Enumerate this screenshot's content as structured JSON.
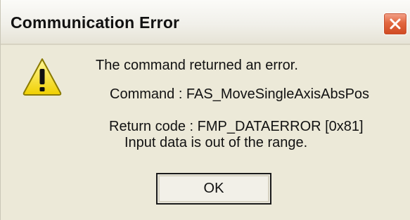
{
  "window": {
    "title": "Communication Error",
    "close_icon": "close-x-icon"
  },
  "message": {
    "icon": "warning-triangle-icon",
    "main": "The command returned an error.",
    "command": "Command : FAS_MoveSingleAxisAbsPos",
    "return_code": "Return code : FMP_DATAERROR [0x81]",
    "description": "Input data is out of the range."
  },
  "buttons": {
    "ok_label": "OK"
  },
  "colors": {
    "dialog_bg": "#ece9d8",
    "close_button": "#d9552c",
    "warning_yellow": "#f5e600"
  }
}
